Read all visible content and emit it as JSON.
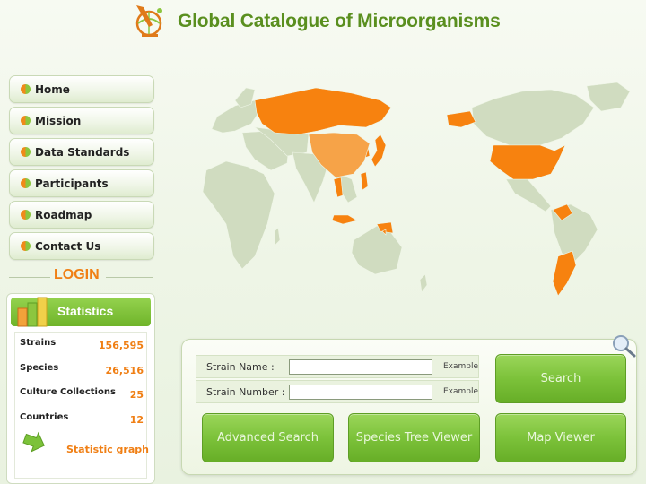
{
  "header": {
    "title": "Global Catalogue of Microorganisms",
    "logo_icon": "microscope-globe-logo"
  },
  "nav": {
    "items": [
      {
        "label": "Home",
        "icon": "bullet-icon"
      },
      {
        "label": "Mission",
        "icon": "bullet-icon"
      },
      {
        "label": "Data Standards",
        "icon": "bullet-icon"
      },
      {
        "label": "Participants",
        "icon": "bullet-icon"
      },
      {
        "label": "Roadmap",
        "icon": "bullet-icon"
      },
      {
        "label": "Contact Us",
        "icon": "bullet-icon"
      }
    ]
  },
  "login": {
    "label": "LOGIN"
  },
  "statistics": {
    "title": "Statistics",
    "rows": [
      {
        "label": "Strains",
        "value": "156,595"
      },
      {
        "label": "Species",
        "value": "26,516"
      },
      {
        "label": "Culture Collections",
        "value": "25"
      },
      {
        "label": "Countries",
        "value": "12"
      }
    ],
    "graph_label": "Statistic graph"
  },
  "search": {
    "strain_name_label": "Strain Name :",
    "strain_number_label": "Strain Number :",
    "strain_name_value": "",
    "strain_number_value": "",
    "example_label": "Example",
    "search_button": "Search",
    "advanced_search_button": "Advanced Search",
    "species_tree_button": "Species Tree Viewer",
    "map_viewer_button": "Map Viewer"
  },
  "colors": {
    "accent_green": "#7cc23a",
    "accent_orange": "#f07f14",
    "title_green": "#5a8f1f",
    "map_land": "#d0dcc0",
    "map_highlight": "#f7820f"
  }
}
